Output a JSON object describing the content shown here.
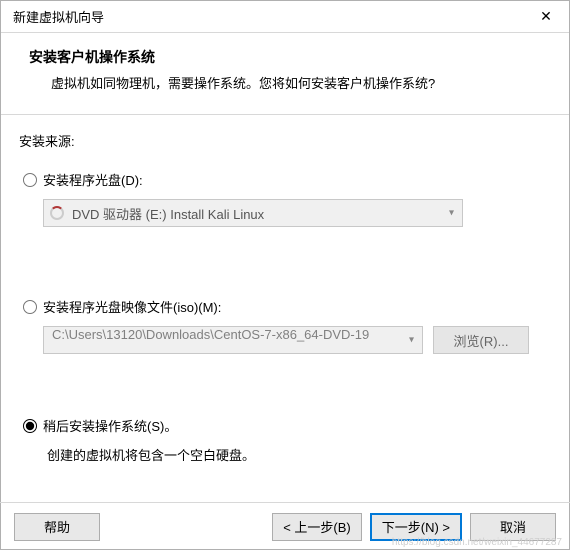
{
  "titlebar": {
    "title": "新建虚拟机向导",
    "close": "✕"
  },
  "header": {
    "heading": "安装客户机操作系统",
    "subtitle": "虚拟机如同物理机，需要操作系统。您将如何安装客户机操作系统?"
  },
  "source_label": "安装来源:",
  "options": {
    "disc": {
      "label": "安装程序光盘(D):",
      "drive_text": "DVD 驱动器 (E:) Install Kali Linux",
      "selected": false
    },
    "iso": {
      "label": "安装程序光盘映像文件(iso)(M):",
      "path": "C:\\Users\\13120\\Downloads\\CentOS-7-x86_64-DVD-19",
      "browse": "浏览(R)...",
      "selected": false
    },
    "later": {
      "label": "稍后安装操作系统(S)。",
      "note": "创建的虚拟机将包含一个空白硬盘。",
      "selected": true
    }
  },
  "footer": {
    "help": "帮助",
    "back": "< 上一步(B)",
    "next": "下一步(N) >",
    "cancel": "取消"
  },
  "watermark": "https://blog.csdn.net/weixin_44677287"
}
